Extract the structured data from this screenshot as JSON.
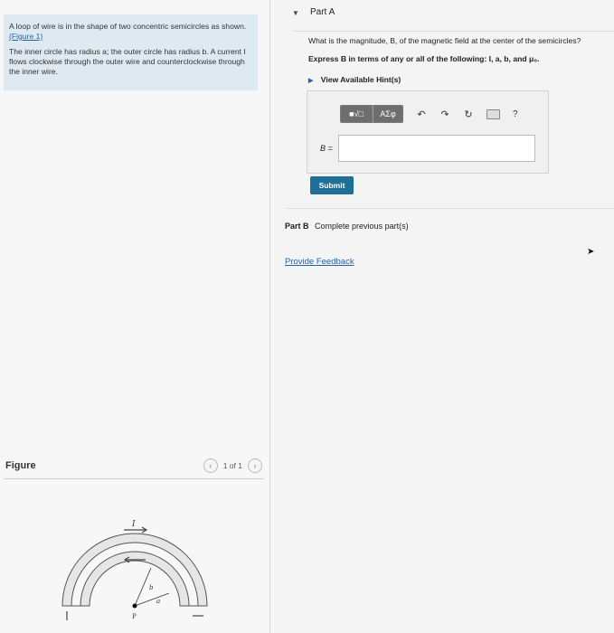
{
  "problem": {
    "para1_text": "A loop of wire is in the shape of two concentric semicircles as shown.",
    "figure_link": "(Figure 1)",
    "para2_text": "The inner circle has radius a; the outer circle has radius b. A current I flows clockwise through the outer wire and counterclockwise through the inner wire."
  },
  "figure": {
    "title": "Figure",
    "pager_text": "1 of 1",
    "prev_icon": "chevron-left-icon",
    "next_icon": "chevron-right-icon",
    "labels": {
      "current": "I",
      "outer_radius": "b",
      "inner_radius": "a",
      "point": "P"
    }
  },
  "part_a": {
    "title": "Part A",
    "question": "What is the magnitude, B, of the magnetic field at the center of the semicircles?",
    "express": "Express B in terms of any or all of the following: I, a, b, and μ₀.",
    "hints_label": "View Available Hint(s)",
    "toolbar": {
      "templates_label": "■√□",
      "greek_label": "ΑΣφ",
      "undo_icon": "↶",
      "redo_icon": "↷",
      "reset_icon": "↻",
      "help_label": "?"
    },
    "answer_label": "B =",
    "answer_value": "",
    "submit_label": "Submit"
  },
  "part_b": {
    "title": "Part B",
    "status": "Complete previous part(s)"
  },
  "feedback_label": "Provide Feedback"
}
